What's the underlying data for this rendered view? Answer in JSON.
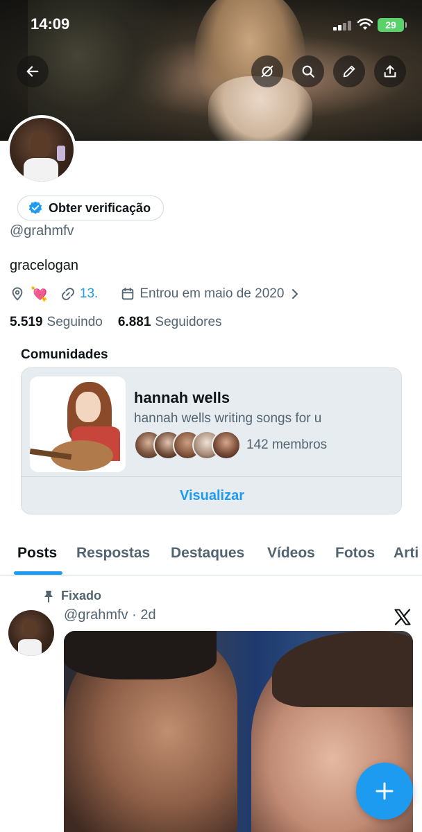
{
  "status_bar": {
    "time": "14:09",
    "battery": "29"
  },
  "profile": {
    "verify_label": "Obter verificação",
    "handle": "@grahmfv",
    "bio": "gracelogan",
    "location_emoji": "💘",
    "link": "13.",
    "joined": "Entrou em maio de 2020",
    "following_count": "5.519",
    "following_label": "Seguindo",
    "followers_count": "6.881",
    "followers_label": "Seguidores"
  },
  "communities": {
    "title": "Comunidades",
    "name": "hannah wells",
    "description": "hannah wells writing songs for u",
    "members": "142 membros",
    "view_label": "Visualizar"
  },
  "tabs": [
    "Posts",
    "Respostas",
    "Destaques",
    "Vídeos",
    "Fotos",
    "Arti"
  ],
  "post": {
    "pinned_label": "Fixado",
    "handle": "@grahmfv",
    "time": "2d"
  },
  "colors": {
    "accent": "#1d9bf0",
    "secondary_text": "#536471",
    "battery": "#5ad16a"
  },
  "icons": [
    "back-arrow-icon",
    "no-sync-icon",
    "search-icon",
    "edit-pencil-icon",
    "share-icon",
    "verified-badge-icon",
    "location-icon",
    "link-icon",
    "calendar-icon",
    "chevron-right-icon",
    "pin-icon",
    "x-logo-icon",
    "plus-icon"
  ]
}
